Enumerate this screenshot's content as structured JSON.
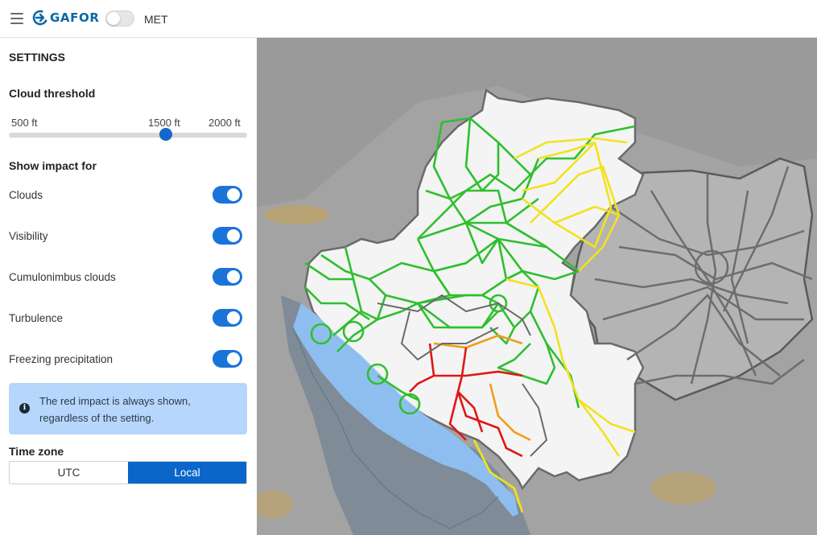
{
  "header": {
    "app_name": "GAFOR",
    "met_label": "MET",
    "met_enabled": false
  },
  "settings": {
    "title": "SETTINGS",
    "cloud_threshold": {
      "title": "Cloud threshold",
      "min_label": "500 ft",
      "value_label": "1500 ft",
      "max_label": "2000 ft",
      "value_ft": 1500
    },
    "impact": {
      "title": "Show impact for",
      "items": [
        {
          "label": "Clouds",
          "enabled": true
        },
        {
          "label": "Visibility",
          "enabled": true
        },
        {
          "label": "Cumulonimbus clouds",
          "enabled": true
        },
        {
          "label": "Turbulence",
          "enabled": true
        },
        {
          "label": "Freezing precipitation",
          "enabled": true
        }
      ]
    },
    "info": {
      "icon": "info-circle-icon",
      "text": "The red impact is always shown, regardless of the setting."
    },
    "time_zone": {
      "title": "Time zone",
      "options": [
        "UTC",
        "Local"
      ],
      "selected": "Local"
    }
  },
  "colors": {
    "accent": "#0b66c9",
    "route_green": "#2fbf2f",
    "route_yellow": "#f2e21d",
    "route_orange": "#f39c1a",
    "route_red": "#e01616",
    "route_grey": "#6d6d6d",
    "sea_area": "#8ec1f3"
  }
}
